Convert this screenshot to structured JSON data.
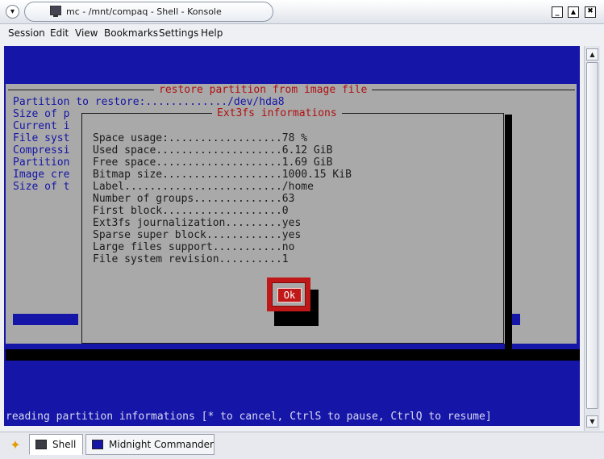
{
  "window": {
    "title": "mc - /mnt/compaq - Shell - Konsole",
    "menu_button": "▾",
    "minimize": "_",
    "maximize": "▲",
    "close": "✖"
  },
  "menubar": [
    "Session",
    "Edit",
    "View",
    "Bookmarks",
    "Settings",
    "Help"
  ],
  "restore_dialog": {
    "title": "restore partition from image file",
    "lines": [
      "Partition to restore:............./dev/hda8",
      "Size of p",
      "Current i",
      "File syst",
      "Compressi",
      "Partition",
      "Image cre",
      "Size of t"
    ]
  },
  "ext3_dialog": {
    "title": "Ext3fs informations",
    "lines": [
      "Space usage:..................78 %",
      "Used space....................6.12 GiB",
      "Free space....................1.69 GiB",
      "Bitmap size...................1000.15 KiB",
      "Label........................./home",
      "Number of groups..............63",
      "First block...................0",
      "Ext3fs journalization.........yes",
      "Sparse super block............yes",
      "Large files support...........no",
      "File system revision..........1"
    ],
    "ok_label": "Ok"
  },
  "status_line": "reading partition informations [* to cancel, CtrlS to pause, CtrlQ to resume]",
  "scrollbar": {
    "up": "▲",
    "down": "▼"
  },
  "taskbar": {
    "new_session_icon": "new-session-icon",
    "tabs": [
      {
        "label": "Shell",
        "active": true
      },
      {
        "label": "Midnight Commander",
        "active": false
      }
    ]
  }
}
